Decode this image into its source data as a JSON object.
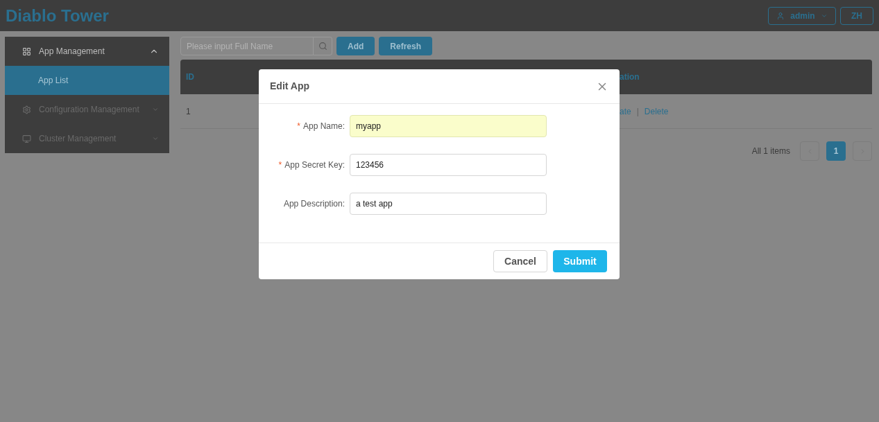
{
  "header": {
    "title": "Diablo Tower",
    "user": "admin",
    "language": "ZH"
  },
  "sidebar": {
    "items": [
      {
        "label": "App Management",
        "expanded": true,
        "children": [
          {
            "label": "App List",
            "selected": true
          }
        ]
      },
      {
        "label": "Configuration Management",
        "expanded": false
      },
      {
        "label": "Cluster Management",
        "expanded": false
      }
    ]
  },
  "toolbar": {
    "search": {
      "placeholder": "Please input Full Name"
    },
    "buttons": [
      "Add",
      "Refresh"
    ]
  },
  "table": {
    "columns": [
      "ID",
      "ation"
    ],
    "rows": [
      {
        "cells": [
          "1"
        ],
        "actions": [
          "ate",
          "Delete"
        ],
        "separator": "|"
      }
    ]
  },
  "pagination": {
    "total": "All 1 items",
    "pages": [
      {
        "label": "1",
        "selected": true
      }
    ]
  },
  "dialog": {
    "title": "Edit App",
    "required_mark": "*",
    "colon": ":",
    "fields": [
      {
        "label": "App Name",
        "required": true,
        "value": "myapp",
        "autofilled": true
      },
      {
        "label": "App Secret Key",
        "required": true,
        "value": "123456",
        "autofilled": false
      },
      {
        "label": "App Description",
        "required": false,
        "value": "a test app",
        "autofilled": false
      }
    ],
    "buttons": [
      {
        "label": "Cancel",
        "kind": "secondary"
      },
      {
        "label": "Submit",
        "kind": "primary"
      }
    ]
  }
}
